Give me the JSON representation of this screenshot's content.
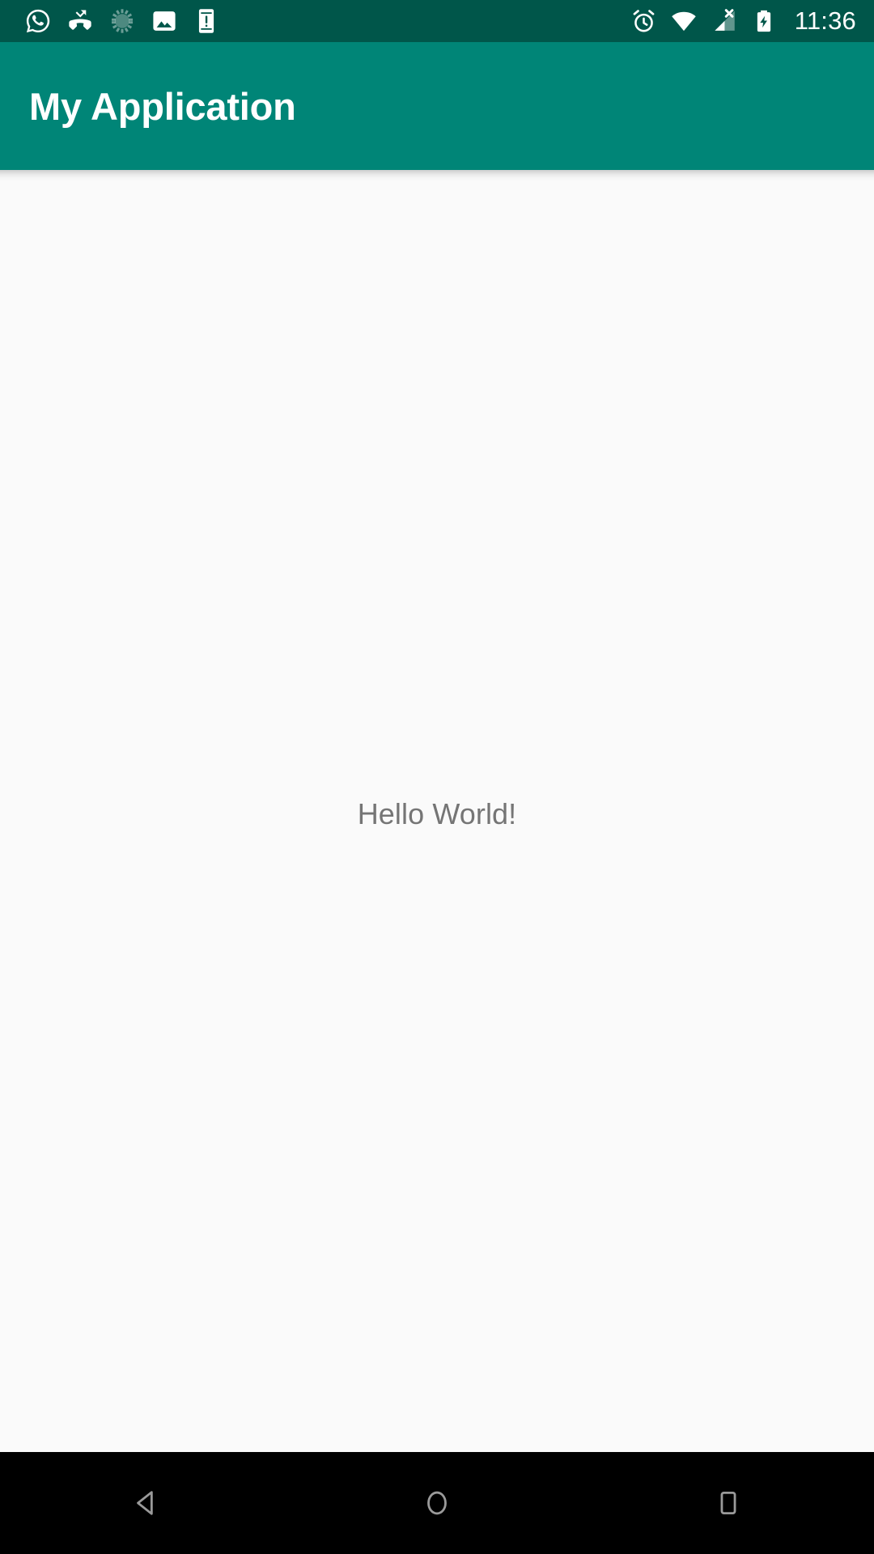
{
  "status_bar": {
    "background_color": "#00564a",
    "foreground_color": "#ffffff",
    "clock": "11:36",
    "left_icons": [
      {
        "name": "whatsapp-icon",
        "label": "WhatsApp notification"
      },
      {
        "name": "missed-call-icon",
        "label": "Missed call"
      },
      {
        "name": "sync-spinner-icon",
        "label": "Syncing"
      },
      {
        "name": "photo-icon",
        "label": "Screenshot captured"
      },
      {
        "name": "phone-alert-icon",
        "label": "Device alert"
      }
    ],
    "right_icons": [
      {
        "name": "alarm-clock-icon",
        "label": "Alarm set"
      },
      {
        "name": "wifi-icon",
        "label": "Wi-Fi full signal"
      },
      {
        "name": "cellular-no-signal-icon",
        "label": "No cellular service"
      },
      {
        "name": "battery-charging-icon",
        "label": "Battery charging"
      }
    ]
  },
  "app_bar": {
    "title": "My Application",
    "background_color": "#008577",
    "title_color": "#ffffff"
  },
  "content": {
    "background_color": "#fafafa",
    "hello_text": "Hello World!",
    "hello_text_color": "#757575"
  },
  "navigation_bar": {
    "background_color": "#000000",
    "icon_color": "#9a9a9a",
    "buttons": [
      {
        "name": "nav-back-button",
        "label": "Back"
      },
      {
        "name": "nav-home-button",
        "label": "Home"
      },
      {
        "name": "nav-recents-button",
        "label": "Recent apps"
      }
    ]
  }
}
